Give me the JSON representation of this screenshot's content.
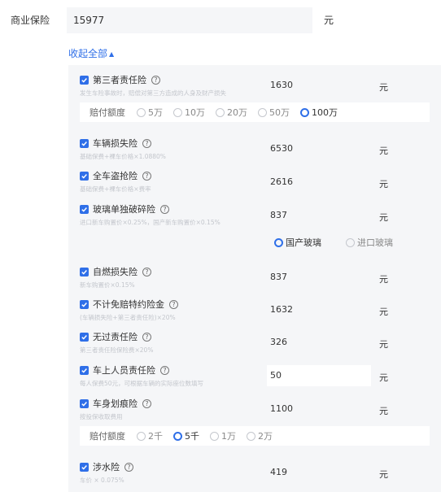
{
  "premium": {
    "label": "商业保险",
    "value": "15977",
    "unit": "元"
  },
  "collapse": {
    "label": "收起全部",
    "arrow": "▲"
  },
  "items": [
    {
      "title": "第三者责任险",
      "desc": "发生车险事故时，赔偿对第三方造成的人身及财产损失",
      "value": "1630",
      "unit": "元"
    },
    {
      "title": "车辆损失险",
      "desc": "基础保费+裸车价格×1.0880%",
      "value": "6530",
      "unit": "元"
    },
    {
      "title": "全车盗抢险",
      "desc": "基础保费+裸车价格×费率",
      "value": "2616",
      "unit": "元"
    },
    {
      "title": "玻璃单独破碎险",
      "desc": "进口新车购置价×0.25%，国产新车购置价×0.15%",
      "value": "837",
      "unit": "元"
    },
    {
      "title": "自燃损失险",
      "desc": "新车购置价×0.15%",
      "value": "837",
      "unit": "元"
    },
    {
      "title": "不计免赔特约险金",
      "desc": "(车辆损失险+第三者责任险)×20%",
      "value": "1632",
      "unit": "元"
    },
    {
      "title": "无过责任险",
      "desc": "第三者责任险保险费×20%",
      "value": "326",
      "unit": "元"
    },
    {
      "title": "车上人员责任险",
      "desc": "每人保费50元，可根据车辆的实际座位数填写",
      "value": "50",
      "unit": "元"
    },
    {
      "title": "车身划痕险",
      "desc": "按投保收取费用",
      "value": "1100",
      "unit": "元"
    },
    {
      "title": "涉水险",
      "desc": "车价 × 0.075%",
      "value": "419",
      "unit": "元"
    }
  ],
  "help_glyph": "?",
  "third_party_limit": {
    "label": "赔付额度",
    "options": [
      "5万",
      "10万",
      "20万",
      "50万",
      "100万"
    ],
    "selected": "100万"
  },
  "glass_type": {
    "options": [
      "国产玻璃",
      "进口玻璃"
    ],
    "selected": "国产玻璃"
  },
  "scratch_limit": {
    "label": "赔付额度",
    "options": [
      "2千",
      "5千",
      "1万",
      "2万"
    ],
    "selected": "5千"
  },
  "colors": {
    "accent": "#2f6fe8",
    "panel": "#f5f6f8",
    "muted": "#c3c6cc"
  }
}
